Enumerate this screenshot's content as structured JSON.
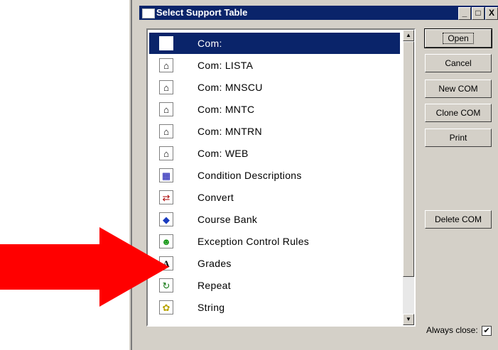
{
  "window": {
    "title": "Select Support Table",
    "controls": [
      "_",
      "□",
      "X"
    ]
  },
  "list": {
    "items": [
      {
        "label": "Com:",
        "icon": "com-icon",
        "selected": true
      },
      {
        "label": "Com:  LISTA",
        "icon": "com-icon",
        "selected": false
      },
      {
        "label": "Com:  MNSCU",
        "icon": "com-icon",
        "selected": false
      },
      {
        "label": "Com:  MNTC",
        "icon": "com-icon",
        "selected": false
      },
      {
        "label": "Com:  MNTRN",
        "icon": "com-icon",
        "selected": false
      },
      {
        "label": "Com:  WEB",
        "icon": "com-icon",
        "selected": false
      },
      {
        "label": "Condition Descriptions",
        "icon": "condition-descriptions-icon",
        "selected": false
      },
      {
        "label": "Convert",
        "icon": "convert-icon",
        "selected": false
      },
      {
        "label": "Course Bank",
        "icon": "course-bank-icon",
        "selected": false
      },
      {
        "label": "Exception Control Rules",
        "icon": "smiley-icon",
        "selected": false
      },
      {
        "label": "Grades",
        "icon": "grades-icon",
        "selected": false
      },
      {
        "label": "Repeat",
        "icon": "repeat-icon",
        "selected": false
      },
      {
        "label": "String",
        "icon": "string-icon",
        "selected": false
      }
    ]
  },
  "buttons": {
    "open": "Open",
    "cancel": "Cancel",
    "new_com": "New COM",
    "clone_com": "Clone COM",
    "print": "Print",
    "delete_com": "Delete COM"
  },
  "always_close": {
    "label": "Always close:",
    "checked": true
  },
  "colors": {
    "titlebar": "#0a246a",
    "selection": "#0a246a",
    "dialog_face": "#d4d0c8",
    "annotation_arrow": "#ff0000"
  }
}
